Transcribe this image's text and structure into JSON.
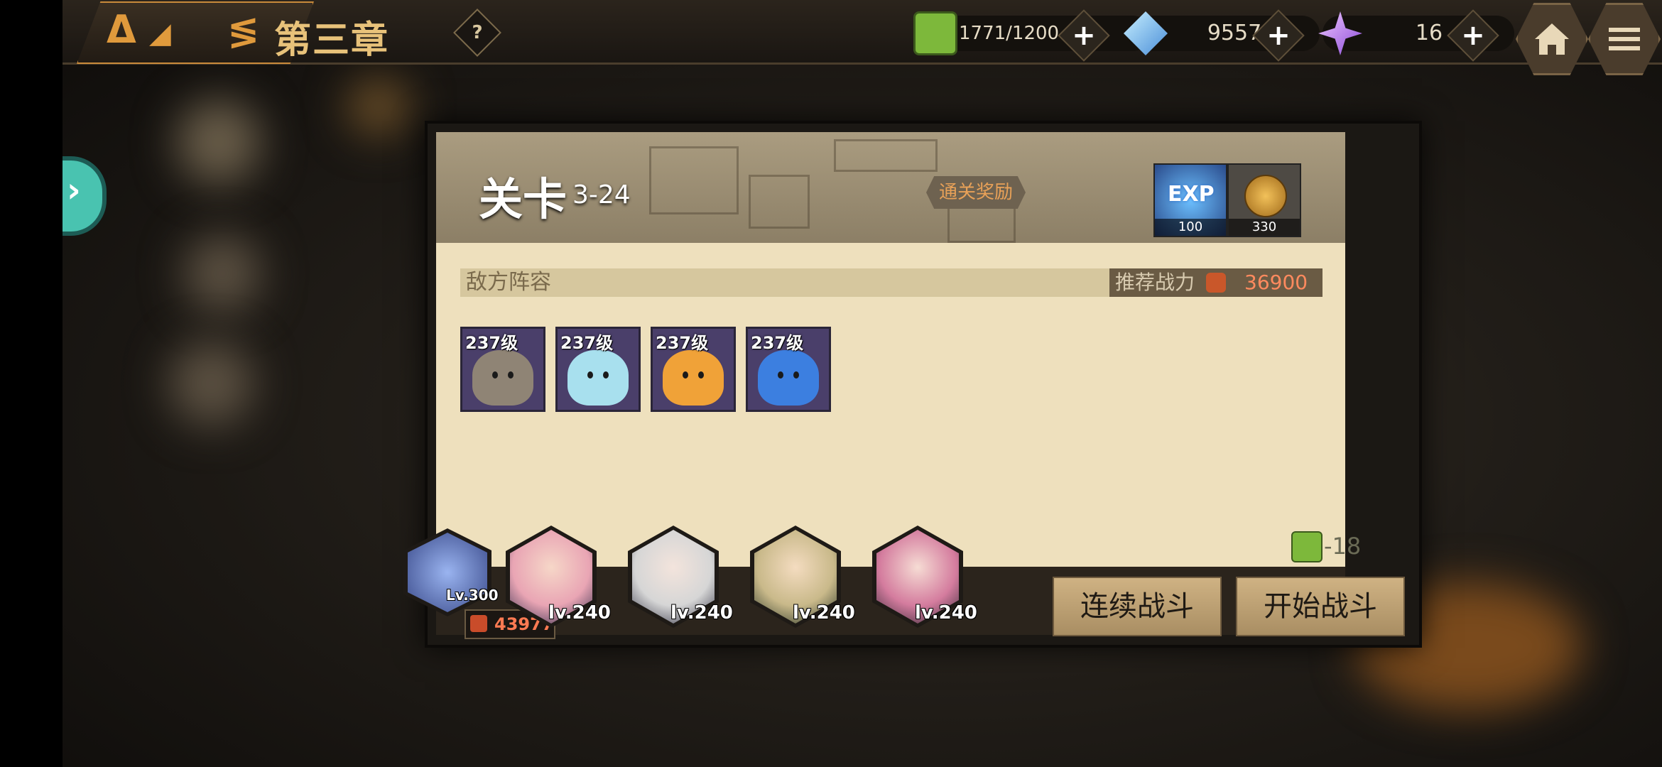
{
  "header": {
    "chapter_title": "第三章",
    "help_label": "?",
    "resources": [
      {
        "name": "energy",
        "icon": "green-cube-icon",
        "value": "1771/1200"
      },
      {
        "name": "diamond",
        "icon": "blue-crystal-icon",
        "value": "9557"
      },
      {
        "name": "star-gem",
        "icon": "purple-crystal-icon",
        "value": "16"
      }
    ],
    "plus_label": "+"
  },
  "side_tab": {
    "label": "›"
  },
  "dialog": {
    "stage_label": "关卡",
    "stage_number": "3-24",
    "reward_label": "通关奖励",
    "rewards": [
      {
        "icon": "exp-icon",
        "text": "EXP",
        "count": "100"
      },
      {
        "icon": "gold-coin-icon",
        "count": "330"
      }
    ],
    "enemy_title": "敌方阵容",
    "recommended_power_label": "推荐战力",
    "recommended_power": "36900",
    "enemies": [
      {
        "level": "237级",
        "type": "rock-slime",
        "color": "#8f8475"
      },
      {
        "level": "237级",
        "type": "ice-slime",
        "color": "#a8e0ee"
      },
      {
        "level": "237级",
        "type": "fire-slime",
        "color": "#f0a238"
      },
      {
        "level": "237级",
        "type": "water-slime",
        "color": "#3c7fe0"
      }
    ],
    "energy_cost": "-18",
    "buttons": {
      "continuous": "连续战斗",
      "start": "开始战斗"
    }
  },
  "team": {
    "pet": {
      "level": "Lv.300"
    },
    "power": "43977",
    "heroes": [
      {
        "level": "lv.240",
        "color": "#e9a5b4"
      },
      {
        "level": "lv.240",
        "color": "#d6d6d6"
      },
      {
        "level": "lv.240",
        "color": "#c9b98a"
      },
      {
        "level": "lv.240",
        "color": "#d47c9e"
      }
    ]
  },
  "colors": {
    "accent": "#e09a3c",
    "panel": "#eee0bd",
    "header_text": "#e8c27a"
  }
}
